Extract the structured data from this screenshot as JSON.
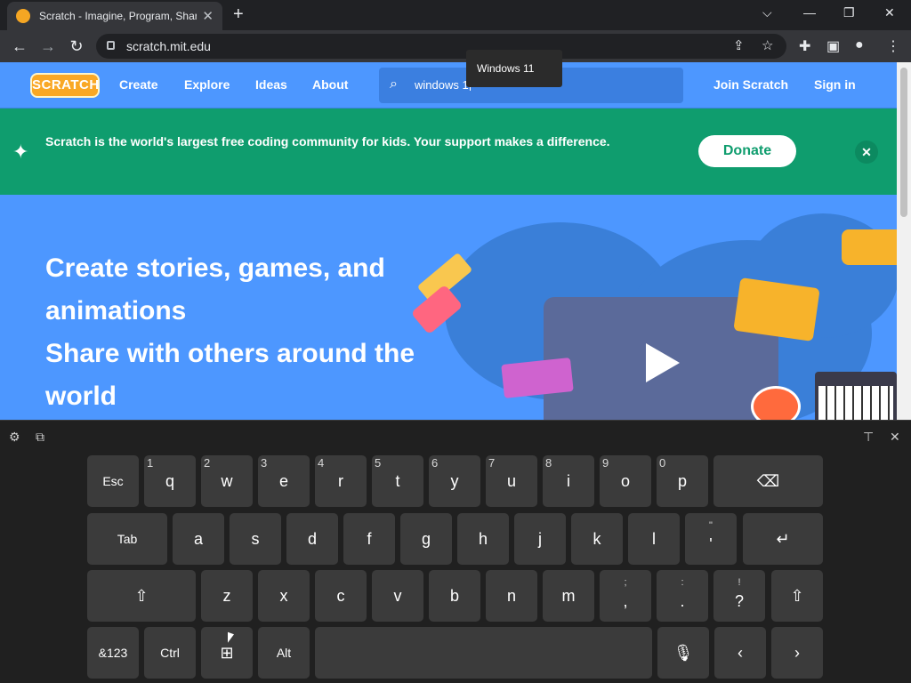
{
  "browser": {
    "tab_title": "Scratch - Imagine, Program, Share",
    "url": "scratch.mit.edu"
  },
  "site": {
    "logo_text": "SCRATCH",
    "nav": [
      "Create",
      "Explore",
      "Ideas",
      "About"
    ],
    "search_value": "windows 1",
    "join": "Join Scratch",
    "signin": "Sign in"
  },
  "tooltip": "Windows 11",
  "banner": {
    "message": "Scratch is the world's largest free coding community for kids. Your support makes a difference.",
    "donate": "Donate"
  },
  "hero": {
    "line1": "Create stories, games, and animations",
    "line2": "Share with others around the world"
  },
  "keyboard": {
    "row1": [
      {
        "label": "Esc"
      },
      {
        "label": "q",
        "num": "1"
      },
      {
        "label": "w",
        "num": "2"
      },
      {
        "label": "e",
        "num": "3"
      },
      {
        "label": "r",
        "num": "4"
      },
      {
        "label": "t",
        "num": "5"
      },
      {
        "label": "y",
        "num": "6"
      },
      {
        "label": "u",
        "num": "7"
      },
      {
        "label": "i",
        "num": "8"
      },
      {
        "label": "o",
        "num": "9"
      },
      {
        "label": "p",
        "num": "0"
      }
    ],
    "row2": [
      {
        "label": "Tab"
      },
      {
        "label": "a"
      },
      {
        "label": "s"
      },
      {
        "label": "d"
      },
      {
        "label": "f"
      },
      {
        "label": "g"
      },
      {
        "label": "h"
      },
      {
        "label": "j"
      },
      {
        "label": "k"
      },
      {
        "label": "l"
      },
      {
        "label": "'",
        "sup": "\""
      }
    ],
    "row3": [
      {
        "label": "z"
      },
      {
        "label": "x"
      },
      {
        "label": "c"
      },
      {
        "label": "v"
      },
      {
        "label": "b"
      },
      {
        "label": "n"
      },
      {
        "label": "m"
      },
      {
        "label": ",",
        "sup": ";"
      },
      {
        "label": ".",
        "sup": ":"
      },
      {
        "label": "?",
        "sup": "!"
      }
    ],
    "row4": {
      "sym": "&123",
      "ctrl": "Ctrl",
      "alt": "Alt"
    }
  },
  "colors": {
    "scratch_blue": "#4d97ff",
    "banner_green": "#0f9d6e",
    "keyboard_bg": "#202020",
    "key_bg": "#3b3b3b"
  }
}
